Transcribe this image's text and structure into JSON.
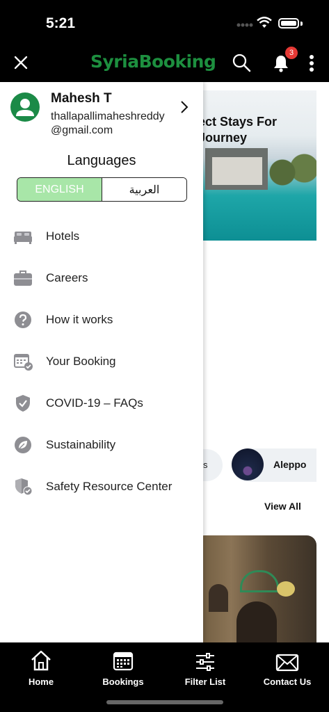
{
  "status_bar": {
    "time": "5:21"
  },
  "app_bar": {
    "logo": "SyriaBooking",
    "notification_count": "3"
  },
  "background": {
    "hero_title": "ect Stays For\nJourney",
    "city_chip_partial": "s",
    "city_chip": "Aleppo",
    "view_all": "View All"
  },
  "drawer": {
    "user": {
      "name": "Mahesh T",
      "email": "thallapallimaheshreddy@gmail.com"
    },
    "languages_title": "Languages",
    "languages": {
      "english": "ENGLISH",
      "arabic": "العربية",
      "selected": "ENGLISH"
    },
    "menu": [
      {
        "label": "Hotels",
        "icon": "bed-icon"
      },
      {
        "label": "Careers",
        "icon": "briefcase-icon"
      },
      {
        "label": "How it works",
        "icon": "question-icon"
      },
      {
        "label": "Your Booking",
        "icon": "calendar-check-icon"
      },
      {
        "label": "COVID-19 – FAQs",
        "icon": "shield-check-icon"
      },
      {
        "label": "Sustainability",
        "icon": "leaf-icon"
      },
      {
        "label": "Safety Resource Center",
        "icon": "shield-badge-icon"
      }
    ]
  },
  "tab_bar": {
    "tabs": [
      {
        "label": "Home",
        "icon": "home-icon"
      },
      {
        "label": "Bookings",
        "icon": "calendar-icon"
      },
      {
        "label": "Filter List",
        "icon": "sliders-icon"
      },
      {
        "label": "Contact Us",
        "icon": "mail-icon"
      }
    ]
  },
  "colors": {
    "brand": "#1d8f3f",
    "selected_lang": "#a8e6a8",
    "badge": "#e53935"
  }
}
